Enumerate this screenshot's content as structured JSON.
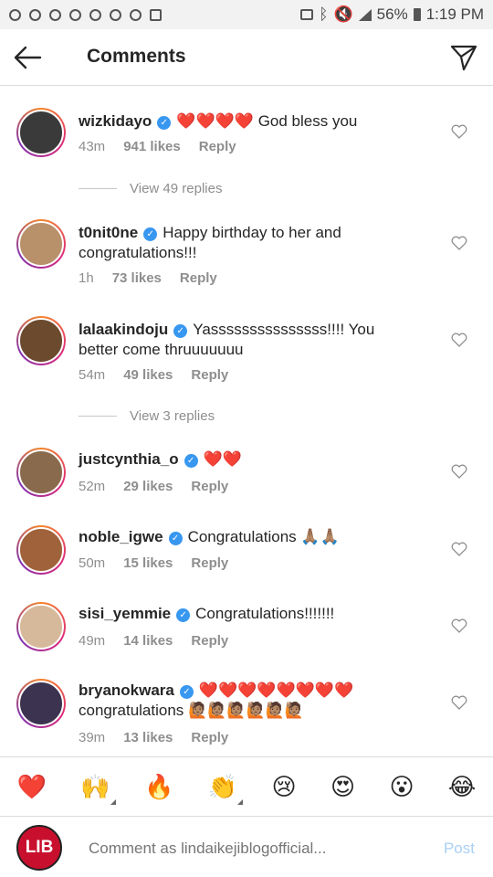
{
  "status": {
    "battery": "56%",
    "time": "1:19 PM"
  },
  "header": {
    "title": "Comments"
  },
  "comments": [
    {
      "user": "wizkidayo",
      "text": "❤️❤️❤️❤️ God bless you",
      "time": "43m",
      "likes": "941 likes",
      "reply": "Reply",
      "avatar_color": "#3a3a3a"
    },
    {
      "user": "t0nit0ne",
      "text": "Happy birthday to her and congratulations!!!",
      "time": "1h",
      "likes": "73 likes",
      "reply": "Reply",
      "avatar_color": "#b8906a"
    },
    {
      "user": "lalaakindoju",
      "text": "Yasssssssssssssss!!!! You better come thruuuuuuu",
      "time": "54m",
      "likes": "49 likes",
      "reply": "Reply",
      "avatar_color": "#6b4a2e"
    },
    {
      "user": "justcynthia_o",
      "text": "❤️❤️",
      "time": "52m",
      "likes": "29 likes",
      "reply": "Reply",
      "avatar_color": "#8a6a4d"
    },
    {
      "user": "noble_igwe",
      "text": "Congratulations 🙏🏽🙏🏽",
      "time": "50m",
      "likes": "15 likes",
      "reply": "Reply",
      "avatar_color": "#a0623a"
    },
    {
      "user": "sisi_yemmie",
      "text": "Congratulations!!!!!!!",
      "time": "49m",
      "likes": "14 likes",
      "reply": "Reply",
      "avatar_color": "#d6b89a"
    },
    {
      "user": "bryanokwara",
      "text": "❤️❤️❤️❤️❤️❤️❤️❤️ congratulations 🙋🏽🙋🏽🙋🏽🙋🏽🙋🏽🙋🏽",
      "time": "39m",
      "likes": "13 likes",
      "reply": "Reply",
      "avatar_color": "#3b3350"
    }
  ],
  "view_replies": [
    "View 49 replies",
    "View 3 replies"
  ],
  "emoji_bar": [
    "❤️",
    "🙌",
    "🔥",
    "👏",
    "😢",
    "😍",
    "😮",
    "😂"
  ],
  "input": {
    "placeholder": "Comment as lindaikejiblogofficial...",
    "post_label": "Post",
    "avatar_text": "LIB"
  }
}
